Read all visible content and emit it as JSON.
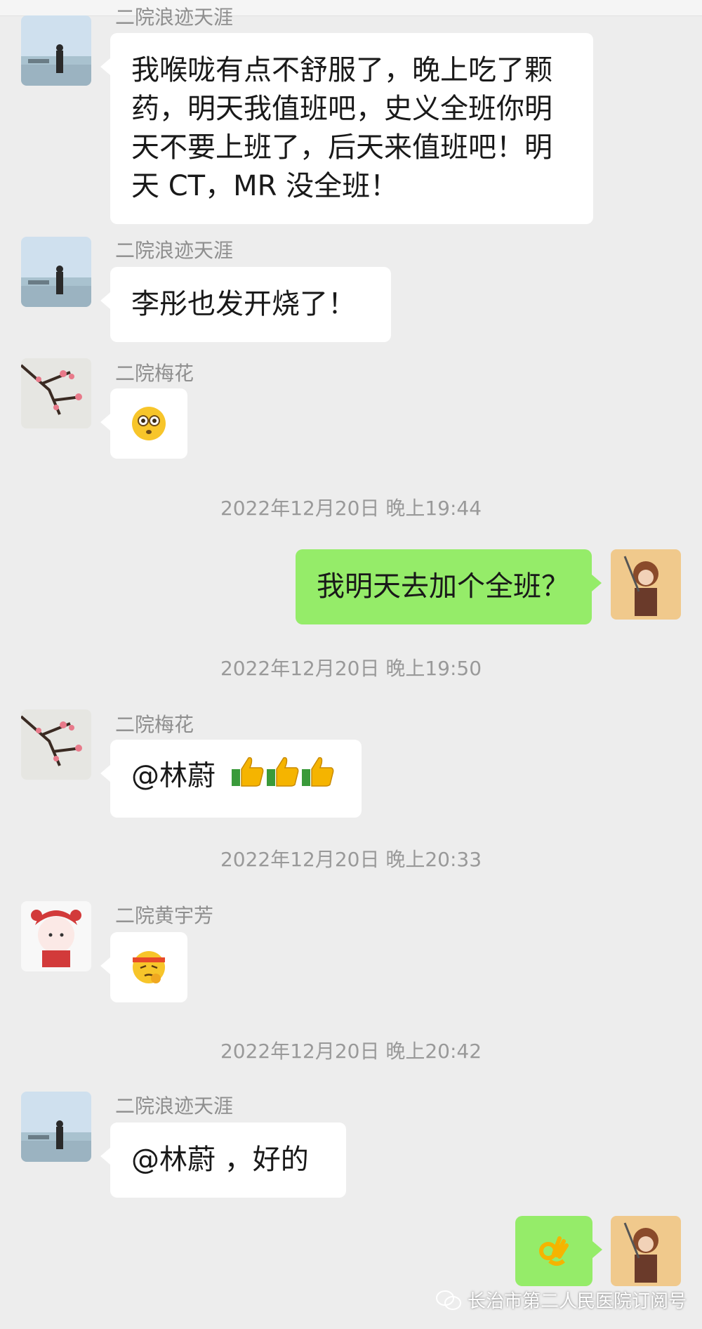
{
  "messages": [
    {
      "sender": "二院浪迹天涯",
      "text_lines": [
        "我喉咙有点不舒服了，晚上吃了颗",
        "药，明天我值班吧，史义全班你明",
        "天不要上班了，后天来值班吧！明",
        "天 CT，MR 没全班！"
      ]
    },
    {
      "sender": "二院浪迹天涯",
      "text": "李彤也发开烧了！"
    },
    {
      "sender": "二院梅花",
      "emoji": "flushed-face-icon"
    },
    {
      "timestamp": "2022年12月20日 晚上19:44"
    },
    {
      "text": "我明天去加个全班？"
    },
    {
      "timestamp": "2022年12月20日 晚上19:50"
    },
    {
      "sender": "二院梅花",
      "text": "@林蔚",
      "emoji": "thumbs-up-icon"
    },
    {
      "timestamp": "2022年12月20日 晚上20:33"
    },
    {
      "sender": "二院黄宇芳",
      "emoji": "headband-thinking-face-icon"
    },
    {
      "timestamp": "2022年12月20日 晚上20:42"
    },
    {
      "sender": "二院浪迹天涯",
      "text": "@林蔚 ，好的"
    },
    {
      "emoji": "ok-hand-icon"
    }
  ],
  "watermark": "长治市第二人民医院订阅号",
  "colors": {
    "background": "#ededed",
    "own_bubble": "#95ec69",
    "other_bubble": "#ffffff",
    "meta_text": "#999999"
  }
}
